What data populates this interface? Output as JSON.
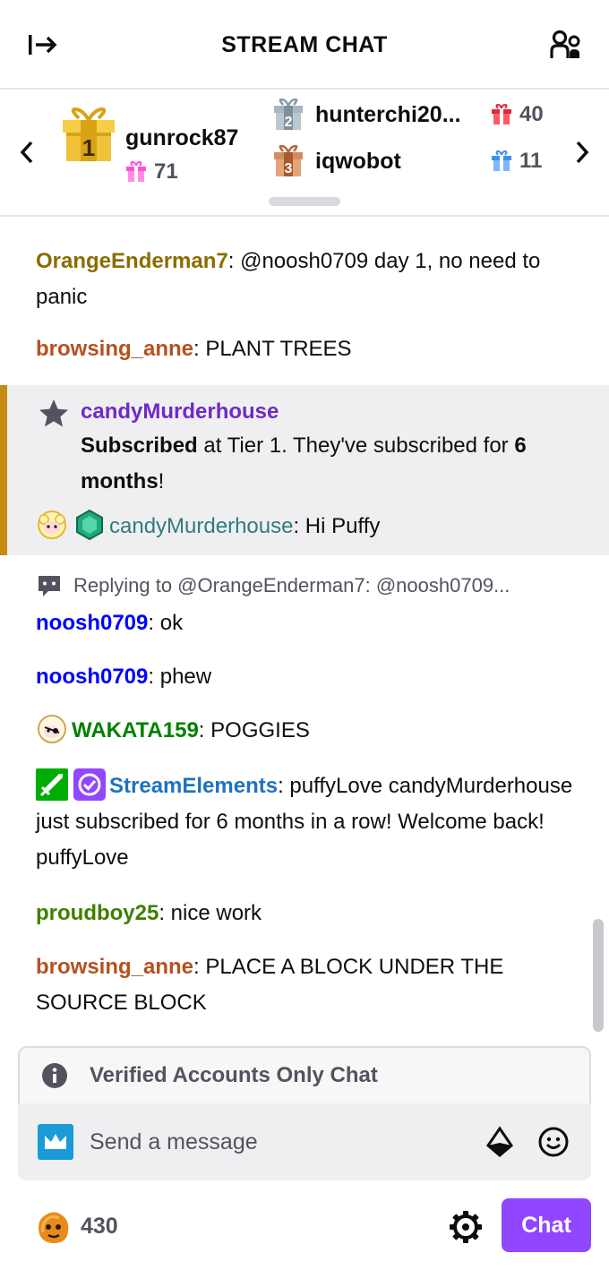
{
  "header": {
    "title": "STREAM CHAT"
  },
  "leaderboard": {
    "first": {
      "name": "gunrock87",
      "count": "71"
    },
    "second": {
      "name": "hunterchi20...",
      "count": "40"
    },
    "third": {
      "name": "iqwobot",
      "count": "11"
    }
  },
  "messages": [
    {
      "user": "OrangeEnderman7",
      "color": "#8a6d00",
      "sep": ":",
      "text": " @noosh0709 day 1, no need to panic"
    },
    {
      "user": "browsing_anne",
      "color": "#b5511f",
      "sep": ":",
      "text": " PLANT TREES"
    }
  ],
  "sub": {
    "user": "candyMurderhouse",
    "bold1": "Subscribed",
    "text1": " at Tier 1. They've subscribed for ",
    "bold2": "6 months",
    "text2": "!",
    "msg_user": "candyMurderhouse",
    "msg_color": "#2e7d7d",
    "msg_text": " Hi Puffy"
  },
  "reply": {
    "text": "Replying to @OrangeEnderman7: @noosh0709..."
  },
  "messages2": [
    {
      "user": "noosh0709",
      "color": "#0000ff",
      "sep": ":",
      "text": " ok"
    },
    {
      "user": "noosh0709",
      "color": "#0000ff",
      "sep": ":",
      "text": " phew"
    },
    {
      "user": "WAKATA159",
      "color": "#008000",
      "sep": ":",
      "text": " POGGIES"
    },
    {
      "user": "StreamElements",
      "color": "#1e73be",
      "sep": ":",
      "text": " puffyLove candyMurderhouse just subscribed for 6 months in a row! Welcome back! puffyLove"
    },
    {
      "user": "proudboy25",
      "color": "#3f7f00",
      "sep": ":",
      "text": " nice work"
    },
    {
      "user": "browsing_anne",
      "color": "#b5511f",
      "sep": ":",
      "text": " PLACE A BLOCK UNDER THE SOURCE BLOCK"
    }
  ],
  "composer": {
    "notice": "Verified Accounts Only Chat",
    "placeholder": "Send a message"
  },
  "footer": {
    "points": "430",
    "chat_button": "Chat"
  },
  "icons": {
    "collapse": "collapse-right-icon",
    "community": "community-icon",
    "gift": "gift-icon",
    "star": "star-icon",
    "reply": "reply-icon",
    "info": "info-icon",
    "prime": "prime-crown-icon",
    "bits": "bits-icon",
    "emote": "emote-icon",
    "settings": "gear-icon"
  },
  "colors": {
    "accent": "#9147ff",
    "sub_border": "#c78b14",
    "sub_name": "#6f2bc5"
  }
}
